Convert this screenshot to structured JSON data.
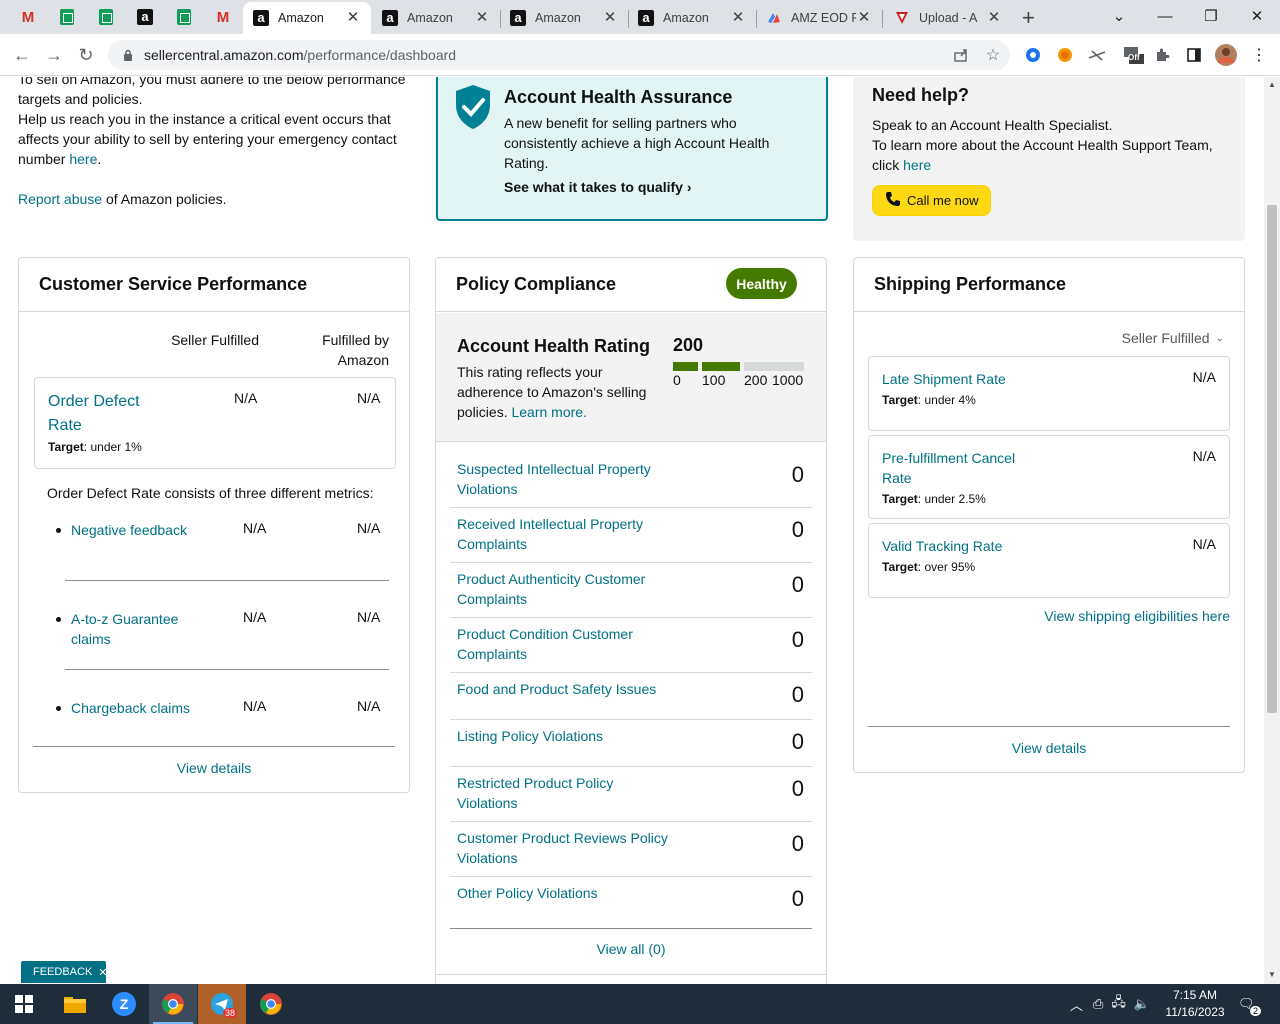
{
  "browser": {
    "tabs": [
      {
        "title": "Amazon",
        "active": true
      },
      {
        "title": "Amazon",
        "active": false
      },
      {
        "title": "Amazon",
        "active": false
      },
      {
        "title": "Amazon",
        "active": false
      },
      {
        "title": "AMZ EOD F",
        "active": false
      },
      {
        "title": "Upload - A",
        "active": false
      }
    ],
    "url_host": "sellercentral.amazon.com",
    "url_path": "/performance/dashboard",
    "extension_badge": "Off"
  },
  "intro": {
    "line1": "To sell on Amazon, you must adhere to the below performance targets and policies.",
    "line2_prefix": "Help us reach you in the instance a critical event occurs that affects your ability to sell by entering your emergency contact number ",
    "line2_link": "here",
    "line2_suffix": ".",
    "report_link": "Report abuse",
    "report_suffix": " of Amazon policies."
  },
  "aha": {
    "title": "Account Health Assurance",
    "description": "A new benefit for selling partners who consistently achieve a high Account Health Rating.",
    "link": "See what it takes to qualify"
  },
  "help": {
    "title": "Need help?",
    "line1": "Speak to an Account Health Specialist.",
    "line2": "To learn more about the Account Health Support Team, click ",
    "link": "here",
    "call_button": "Call me now"
  },
  "customer_service": {
    "title": "Customer Service Performance",
    "col1": "Seller Fulfilled",
    "col2": "Fulfilled by Amazon",
    "odr": {
      "name": "Order Defect Rate",
      "target_label": "Target",
      "target_value": ": under 1%",
      "v1": "N/A",
      "v2": "N/A"
    },
    "consists": "Order Defect Rate consists of three different metrics:",
    "metrics": [
      {
        "name": "Negative feedback",
        "v1": "N/A",
        "v2": "N/A"
      },
      {
        "name": "A-to-z Guarantee claims",
        "v1": "N/A",
        "v2": "N/A"
      },
      {
        "name": "Chargeback claims",
        "v1": "N/A",
        "v2": "N/A"
      }
    ],
    "view_details": "View details"
  },
  "policy": {
    "title": "Policy Compliance",
    "status": "Healthy",
    "ahr_title": "Account Health Rating",
    "ahr_desc": "This rating reflects your adherence to Amazon's selling policies. ",
    "ahr_link": "Learn more.",
    "ahr_score": "200",
    "ahr_ticks": [
      "0",
      "100",
      "200",
      "1000"
    ],
    "rows": [
      {
        "name": "Suspected Intellectual Property Violations",
        "value": "0"
      },
      {
        "name": "Received Intellectual Property Complaints",
        "value": "0"
      },
      {
        "name": "Product Authenticity Customer Complaints",
        "value": "0"
      },
      {
        "name": "Product Condition Customer Complaints",
        "value": "0"
      },
      {
        "name": "Food and Product Safety Issues",
        "value": "0"
      },
      {
        "name": "Listing Policy Violations",
        "value": "0"
      },
      {
        "name": "Restricted Product Policy Violations",
        "value": "0"
      },
      {
        "name": "Customer Product Reviews Policy Violations",
        "value": "0"
      },
      {
        "name": "Other Policy Violations",
        "value": "0"
      }
    ],
    "view_all": "View all (0)"
  },
  "shipping": {
    "title": "Shipping Performance",
    "filter": "Seller Fulfilled",
    "metrics": [
      {
        "name": "Late Shipment Rate",
        "value": "N/A",
        "target_label": "Target",
        "target_value": ": under 4%"
      },
      {
        "name": "Pre-fulfillment Cancel Rate",
        "value": "N/A",
        "target_label": "Target",
        "target_value": ": under 2.5%"
      },
      {
        "name": "Valid Tracking Rate",
        "value": "N/A",
        "target_label": "Target",
        "target_value": ": over 95%"
      }
    ],
    "eligibility_link": "View shipping eligibilities here",
    "view_details": "View details"
  },
  "feedback": "FEEDBACK",
  "taskbar": {
    "time": "7:15 AM",
    "date": "11/16/2023",
    "telegram_badge": "38",
    "notification_count": "2"
  }
}
